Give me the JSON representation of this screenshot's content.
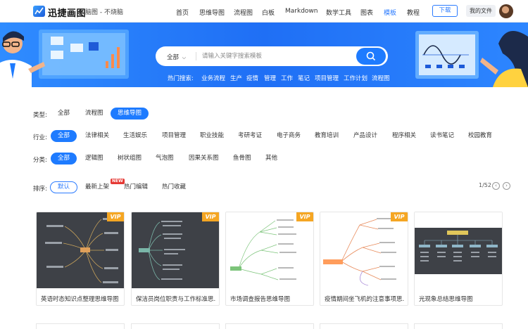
{
  "header": {
    "logo_text": "迅捷画图",
    "site_sub": "脑图 - 不烧脑",
    "nav": [
      "首页",
      "思维导图",
      "流程图",
      "白板",
      "Markdown",
      "数学工具",
      "图表",
      "模板",
      "教程"
    ],
    "active_nav": "模板",
    "download_label": "下载",
    "myfiles_label": "我的文件"
  },
  "search": {
    "scope": "全部",
    "placeholder": "请输入关键字搜索模板",
    "hot_label": "热门搜索:",
    "hot_tags": [
      "业务流程",
      "生产",
      "疫情",
      "管理",
      "工作",
      "笔记",
      "项目管理",
      "工作计划",
      "流程图"
    ]
  },
  "filters": {
    "type": {
      "label": "类型:",
      "options": [
        "全部",
        "流程图",
        "思维导图"
      ],
      "selected": "思维导图"
    },
    "industry": {
      "label": "行业:",
      "options": [
        "全部",
        "法律相关",
        "生活娱乐",
        "项目管理",
        "职业技能",
        "考研考证",
        "电子商务",
        "教育培训",
        "产品设计",
        "程序相关",
        "读书笔记",
        "校园教育"
      ],
      "selected": "全部"
    },
    "category": {
      "label": "分类:",
      "options": [
        "全部",
        "逻辑图",
        "树状组图",
        "气泡图",
        "因果关系图",
        "鱼骨图",
        "其他"
      ],
      "selected": "全部"
    },
    "sort": {
      "label": "排序:",
      "options": [
        "默认",
        "最新上架",
        "热门编辑",
        "热门收藏"
      ],
      "selected": "默认",
      "new_badge": "NEW"
    }
  },
  "pager": {
    "text": "1/52",
    "prev": "‹",
    "next": "›"
  },
  "templates": [
    {
      "title": "英语时态知识点整理思维导图",
      "vip": "VIP",
      "theme": "dark"
    },
    {
      "title": "保洁员岗位职责与工作标准思...",
      "vip": "VIP",
      "theme": "dark"
    },
    {
      "title": "市场调查报告思维导图",
      "vip": "VIP",
      "theme": "light"
    },
    {
      "title": "疫情期间坐飞机的注意事项思...",
      "vip": "VIP",
      "theme": "light"
    },
    {
      "title": "光现象总结思维导图",
      "vip": "",
      "theme": "dark"
    }
  ]
}
